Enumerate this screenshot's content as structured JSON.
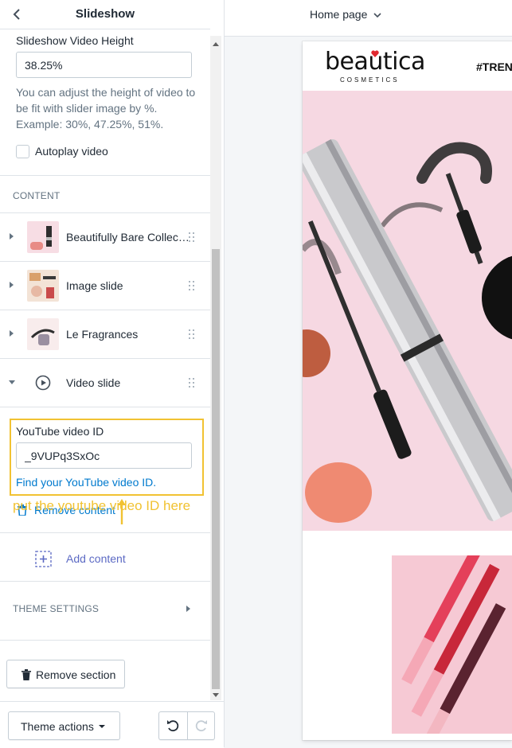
{
  "sidebar": {
    "title": "Slideshow",
    "video_height": {
      "label": "Slideshow Video Height",
      "value": "38.25%",
      "help": "You can adjust the height of video to be fit with slider image by %. Example: 30%, 47.25%, 51%."
    },
    "autoplay_label": "Autoplay video",
    "content_heading": "CONTENT",
    "blocks": [
      {
        "label": "Beautifully Bare Collect…",
        "thumb": "lipstick-thumb"
      },
      {
        "label": "Image slide",
        "thumb": "flatlay-thumb"
      },
      {
        "label": "Le Fragrances",
        "thumb": "perfume-thumb"
      },
      {
        "label": "Video slide",
        "icon": "play-circle-icon"
      }
    ],
    "youtube": {
      "label": "YouTube video ID",
      "value": "_9VUPq3SxOc",
      "help_link": "Find your YouTube video ID."
    },
    "remove_content": "Remove content",
    "add_content": "Add content",
    "theme_settings": "THEME SETTINGS",
    "remove_section": "Remove section",
    "theme_actions": "Theme actions"
  },
  "annotation": "put the youtube video ID here",
  "preview": {
    "page_select": "Home page",
    "logo": "beautica",
    "logo_sub": "COSMETICS",
    "trending": "#TREN"
  },
  "colors": {
    "link": "#007ace",
    "annotation": "#f1c232",
    "hero_bg": "#f6d8e2"
  }
}
